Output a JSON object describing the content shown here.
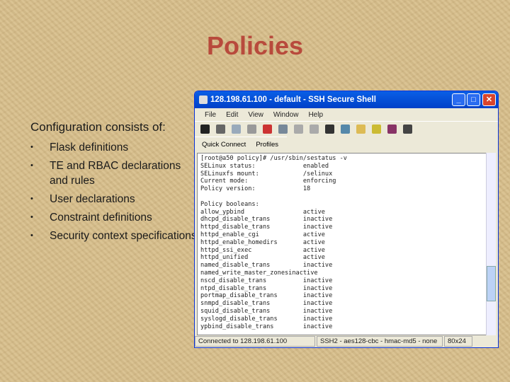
{
  "slide": {
    "title": "Policies",
    "intro": "Configuration consists of:",
    "bullets": [
      "Flask definitions",
      "TE and RBAC declarations and rules",
      "User declarations",
      "Constraint definitions",
      "Security context specifications."
    ]
  },
  "window": {
    "title": "128.198.61.100 - default - SSH Secure Shell",
    "menu": [
      "File",
      "Edit",
      "View",
      "Window",
      "Help"
    ],
    "quick_connect": "Quick Connect",
    "profiles": "Profiles",
    "terminal_lines": [
      "[root@a50 policy]# /usr/sbin/sestatus -v",
      "SELinux status:             enabled",
      "SELinuxfs mount:            /selinux",
      "Current mode:               enforcing",
      "Policy version:             18",
      "",
      "Policy booleans:",
      "allow_ypbind                active",
      "dhcpd_disable_trans         inactive",
      "httpd_disable_trans         inactive",
      "httpd_enable_cgi            active",
      "httpd_enable_homedirs       active",
      "httpd_ssi_exec              active",
      "httpd_unified               active",
      "named_disable_trans         inactive",
      "named_write_master_zonesinactive",
      "nscd_disable_trans          inactive",
      "ntpd_disable_trans          inactive",
      "portmap_disable_trans       inactive",
      "snmpd_disable_trans         inactive",
      "squid_disable_trans         inactive",
      "syslogd_disable_trans       inactive",
      "ypbind_disable_trans        inactive"
    ],
    "status": {
      "connected": "Connected to 128.198.61.100",
      "cipher": "SSH2 - aes128-cbc - hmac-md5 - none",
      "size": "80x24"
    }
  }
}
